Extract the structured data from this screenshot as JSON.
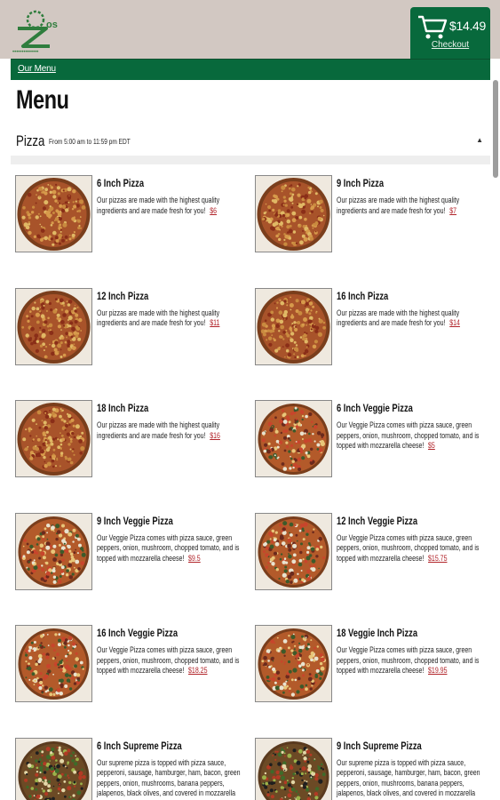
{
  "header": {
    "cart_total": "$14.49",
    "checkout_label": "Checkout"
  },
  "nav": {
    "our_menu": "Our Menu"
  },
  "page": {
    "title": "Menu"
  },
  "section": {
    "name": "Pizza",
    "hours": "From 5:00 am to 11:59 pm EDT"
  },
  "items": [
    {
      "name": "6 Inch Pizza",
      "desc": "Our pizzas are made with the highest quality ingredients and are made fresh for you!",
      "price": "$6",
      "style": "pepperoni"
    },
    {
      "name": "9 Inch Pizza",
      "desc": "Our pizzas are made with the highest quality ingredients and are made fresh for you!",
      "price": "$7",
      "style": "pepperoni"
    },
    {
      "name": "12 Inch Pizza",
      "desc": "Our pizzas are made with the highest quality ingredients and are made fresh for you!",
      "price": "$11",
      "style": "pepperoni"
    },
    {
      "name": "16 Inch Pizza",
      "desc": "Our pizzas are made with the highest quality ingredients and are made fresh for you!",
      "price": "$14",
      "style": "pepperoni"
    },
    {
      "name": "18 Inch Pizza",
      "desc": "Our pizzas are made with the highest quality ingredients and are made fresh for you!",
      "price": "$16",
      "style": "pepperoni"
    },
    {
      "name": "6 Inch Veggie Pizza",
      "desc": "Our Veggie Pizza comes with pizza sauce, green peppers, onion, mushroom, chopped tomato, and is topped with mozzarella cheese!",
      "price": "$5",
      "style": "veggie"
    },
    {
      "name": "9 Inch Veggie Pizza",
      "desc": "Our Veggie Pizza comes with pizza sauce, green peppers, onion, mushroom, chopped tomato, and is topped with mozzarella cheese!",
      "price": "$9.5",
      "style": "veggie"
    },
    {
      "name": "12 Inch Veggie Pizza",
      "desc": "Our Veggie Pizza comes with pizza sauce, green peppers, onion, mushroom, chopped tomato, and is topped with mozzarella cheese!",
      "price": "$15.75",
      "style": "veggie"
    },
    {
      "name": "16 Inch Veggie Pizza",
      "desc": "Our Veggie Pizza comes with pizza sauce, green peppers, onion, mushroom, chopped tomato, and is topped with mozzarella cheese!",
      "price": "$18.25",
      "style": "veggie"
    },
    {
      "name": "18 Veggie Inch Pizza",
      "desc": "Our Veggie Pizza comes with pizza sauce, green peppers, onion, mushroom, chopped tomato, and is topped with mozzarella cheese!",
      "price": "$19.95",
      "style": "veggie"
    },
    {
      "name": "6 Inch Supreme Pizza",
      "desc": "Our supreme pizza is topped with pizza sauce, pepperoni, sausage, hamburger, ham, bacon, green peppers, onion, mushrooms, banana peppers, jalapenos, black olives, and covered in mozzarella",
      "price": "",
      "style": "supreme"
    },
    {
      "name": "9 Inch Supreme Pizza",
      "desc": "Our supreme pizza is topped with pizza sauce, pepperoni, sausage, hamburger, ham, bacon, green peppers, onion, mushrooms, banana peppers, jalapenos, black olives, and covered in mozzarella",
      "price": "",
      "style": "supreme"
    }
  ],
  "colors": {
    "brand_green": "#08693c",
    "header_bg": "#d2c8c2",
    "price_red": "#b1242a"
  },
  "icons": {
    "cart": "shopping-cart-icon",
    "caret": "caret-up-icon",
    "logo": "z-logo"
  }
}
